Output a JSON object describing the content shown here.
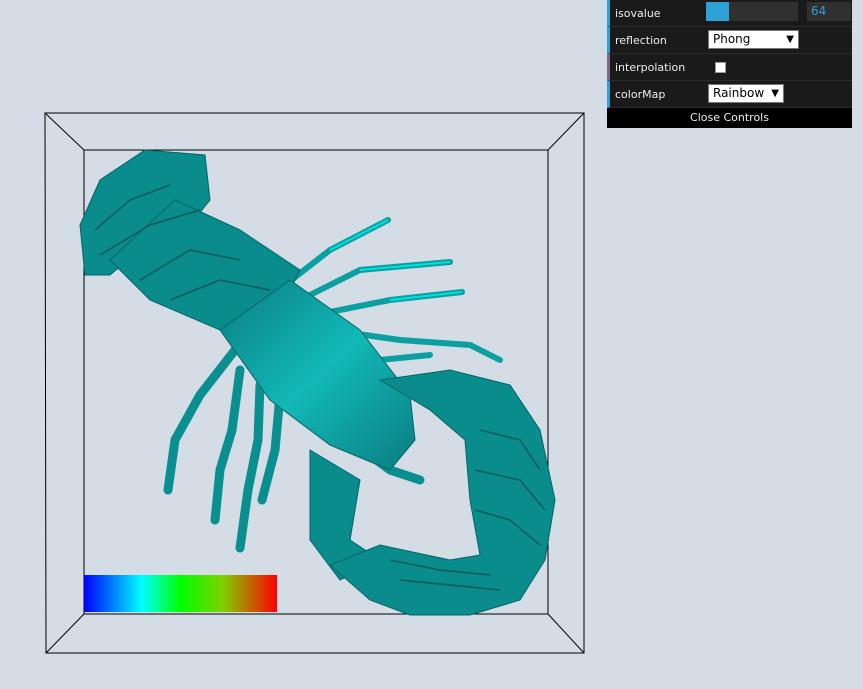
{
  "controls": {
    "isovalue": {
      "label": "isovalue",
      "value": "64",
      "fill_fraction": 0.25
    },
    "reflection": {
      "label": "reflection",
      "selected": "Phong"
    },
    "interpolation": {
      "label": "interpolation",
      "checked": false
    },
    "colorMap": {
      "label": "colorMap",
      "selected": "Rainbow"
    },
    "close_label": "Close Controls"
  },
  "scene": {
    "surface_color": "#0a8c8c",
    "surface_highlight": "#00e6e6",
    "bounding_box_color": "#000000",
    "background_color": "#d4dce6",
    "colorbar_stops": [
      "#0000ff",
      "#00ffff",
      "#00ff00",
      "#80d000",
      "#ff0000"
    ]
  }
}
